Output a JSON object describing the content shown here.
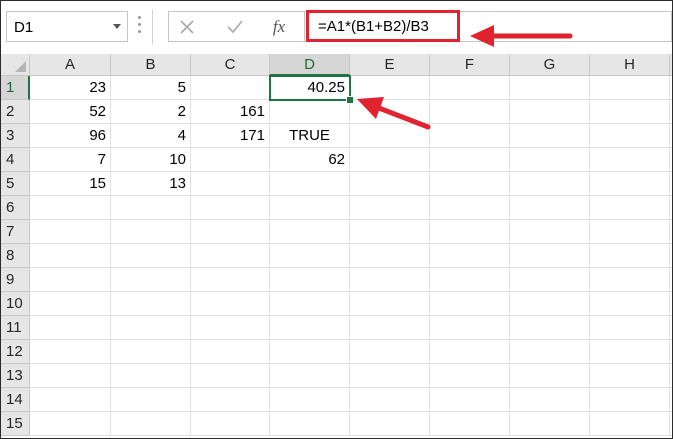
{
  "formula_bar": {
    "name_box": "D1",
    "formula": "=A1*(B1+B2)/B3",
    "cancel_icon": "close-icon",
    "enter_icon": "check-icon",
    "function_icon": "fx-icon",
    "function_label": "fx"
  },
  "sheet": {
    "columns": [
      "A",
      "B",
      "C",
      "D",
      "E",
      "F",
      "G",
      "H"
    ],
    "rows": [
      "1",
      "2",
      "3",
      "4",
      "5",
      "6",
      "7",
      "8",
      "9",
      "10",
      "11",
      "12",
      "13",
      "14",
      "15"
    ],
    "active_cell": "D1",
    "cells": {
      "A1": "23",
      "B1": "5",
      "D1": "40.25",
      "A2": "52",
      "B2": "2",
      "C2": "161",
      "A3": "96",
      "B3": "4",
      "C3": "171",
      "D3": "TRUE",
      "A4": "7",
      "B4": "10",
      "D4": "62",
      "A5": "15",
      "B5": "13"
    }
  },
  "annotations": {
    "color": "#e0232f",
    "highlight": "formula-highlight-box",
    "arrows": [
      "arrow-to-formula",
      "arrow-to-active-cell"
    ]
  },
  "colors": {
    "accent": "#217346",
    "annotation": "#e0232f"
  }
}
